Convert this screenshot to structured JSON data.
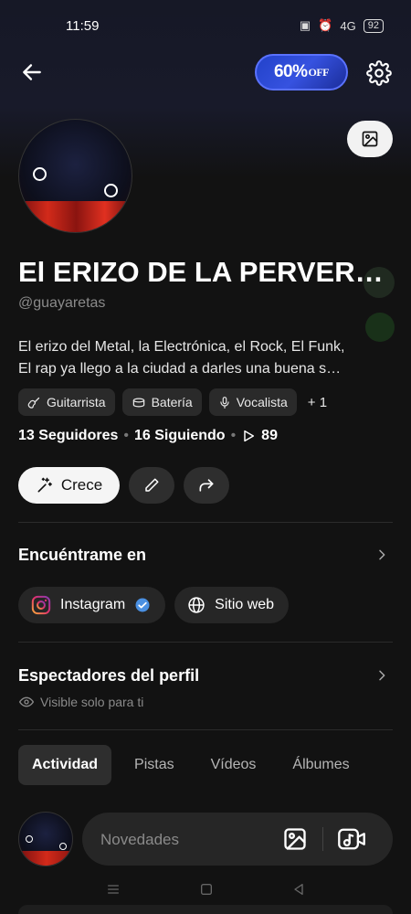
{
  "status": {
    "time": "11:59",
    "signal": "4G",
    "battery": "92"
  },
  "header": {
    "promo_main": "60%",
    "promo_suffix": "OFF"
  },
  "profile": {
    "name": "El ERIZO DE LA PERVERSI…",
    "handle": "@guayaretas",
    "bio_line1": "El erizo del Metal, la Electrónica, el Rock, El Funk,",
    "bio_line2": "El rap ya llego a la ciudad a darles una buena s…",
    "tags": [
      {
        "label": "Guitarrista",
        "icon": "guitar-icon"
      },
      {
        "label": "Batería",
        "icon": "drum-icon"
      },
      {
        "label": "Vocalista",
        "icon": "mic-icon"
      }
    ],
    "tags_more": "+ 1",
    "followers": "13 Seguidores",
    "following": "16 Siguiendo",
    "plays": "89",
    "grow_label": "Crece"
  },
  "find_me": {
    "title": "Encuéntrame en",
    "links": [
      {
        "label": "Instagram",
        "icon": "instagram-icon",
        "verified": true
      },
      {
        "label": "Sitio web",
        "icon": "globe-icon"
      }
    ]
  },
  "viewers": {
    "title": "Espectadores del perfil",
    "note": "Visible solo para ti"
  },
  "tabs": [
    {
      "label": "Actividad",
      "active": true
    },
    {
      "label": "Pistas",
      "active": false
    },
    {
      "label": "Vídeos",
      "active": false
    },
    {
      "label": "Álbumes",
      "active": false
    }
  ],
  "composer": {
    "placeholder": "Novedades"
  },
  "colors": {
    "background": "#121212",
    "promo": "#2f4ad6",
    "verified": "#4a90e2"
  }
}
